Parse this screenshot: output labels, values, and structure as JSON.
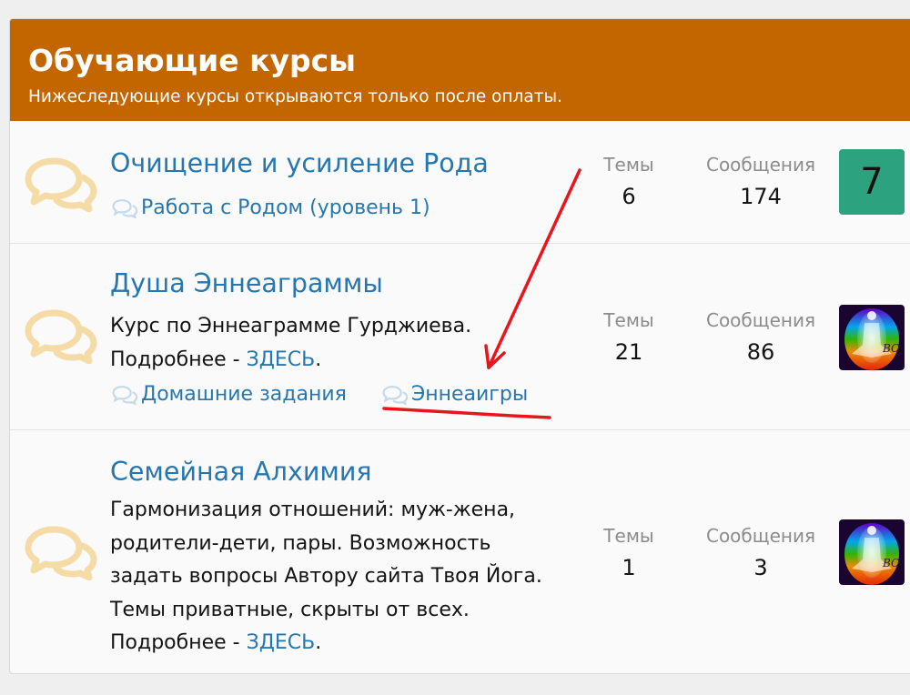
{
  "category": {
    "title": "Обучающие курсы",
    "description": "Нижеследующие курсы открываются только после оплаты."
  },
  "nodes": [
    {
      "title": "Очищение и усиление Рода",
      "subforums": [
        "Работа с Родом (уровень 1)"
      ],
      "threads_label": "Темы",
      "threads": "6",
      "messages_label": "Сообщения",
      "messages": "174",
      "avatar_letter": "7"
    },
    {
      "title": "Душа Эннеаграммы",
      "desc_line1": "Курс по Эннеаграмме Гурджиева.",
      "desc_more": "Подробнее - ",
      "desc_link": "ЗДЕСЬ",
      "desc_end": ".",
      "subforums": [
        "Домашние задания",
        "Эннеаигры"
      ],
      "threads_label": "Темы",
      "threads": "21",
      "messages_label": "Сообщения",
      "messages": "86",
      "avatar_text": "BC"
    },
    {
      "title": "Семейная Алхимия",
      "desc_lines": [
        "Гармонизация отношений: муж-жена,",
        "родители-дети, пары. Возможность",
        "задать вопросы Автору сайта Твоя Йога.",
        "Темы приватные, скрыты от всех."
      ],
      "desc_more": "Подробнее - ",
      "desc_link": "ЗДЕСЬ",
      "desc_end": ".",
      "threads_label": "Темы",
      "threads": "1",
      "messages_label": "Сообщения",
      "messages": "3",
      "avatar_text": "BC"
    }
  ],
  "colors": {
    "header": "#c46600",
    "link": "#2577b1",
    "icon": "#f5dba6",
    "avatar_green": "#2ca37e",
    "annotation": "#e8141e"
  }
}
